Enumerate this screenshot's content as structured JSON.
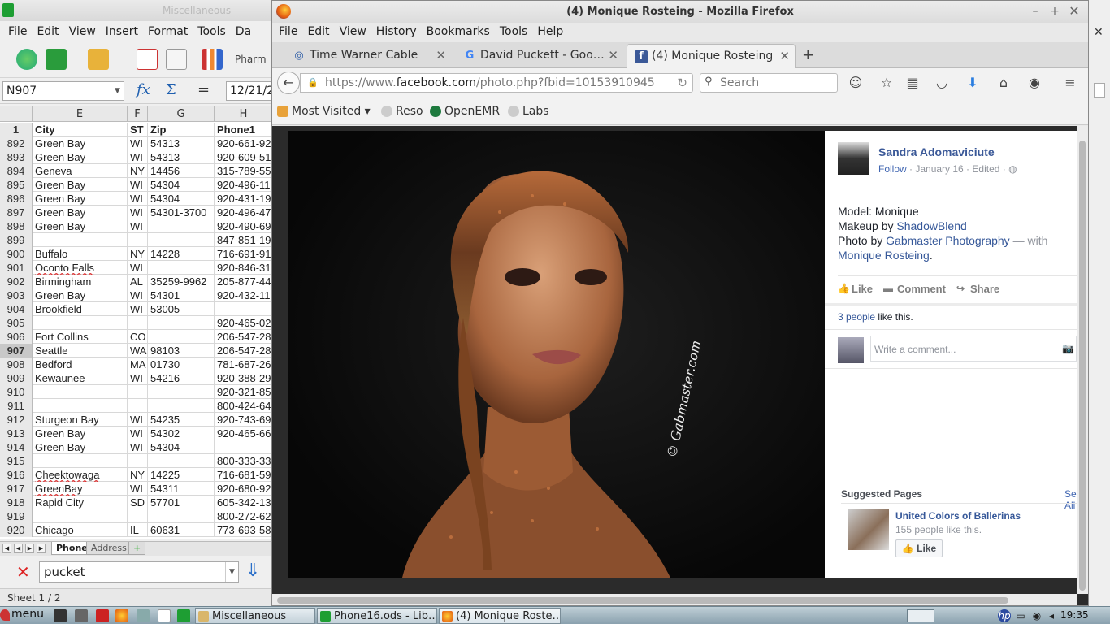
{
  "calc": {
    "title": "Miscellaneous",
    "menu": [
      "File",
      "Edit",
      "View",
      "Insert",
      "Format",
      "Tools",
      "Da"
    ],
    "toolbar_text": "Pharm",
    "name_box": "N907",
    "formula_value": "12/21/2",
    "columns": [
      "E",
      "F",
      "G",
      "H"
    ],
    "rows": [
      {
        "n": "1",
        "city": "City",
        "st": "ST",
        "zip": "Zip",
        "phone": "Phone1",
        "head": true
      },
      {
        "n": "892",
        "city": "Green Bay",
        "st": "WI",
        "zip": "54313",
        "phone": "920-661-92"
      },
      {
        "n": "893",
        "city": "Green Bay",
        "st": "WI",
        "zip": "54313",
        "phone": "920-609-51"
      },
      {
        "n": "894",
        "city": "Geneva",
        "st": "NY",
        "zip": "14456",
        "phone": "315-789-55"
      },
      {
        "n": "895",
        "city": "Green Bay",
        "st": "WI",
        "zip": "54304",
        "phone": "920-496-11"
      },
      {
        "n": "896",
        "city": "Green Bay",
        "st": "WI",
        "zip": "54304",
        "phone": "920-431-19"
      },
      {
        "n": "897",
        "city": "Green Bay",
        "st": "WI",
        "zip": "54301-3700",
        "phone": "920-496-47"
      },
      {
        "n": "898",
        "city": "Green Bay",
        "st": "WI",
        "zip": "",
        "phone": "920-490-69"
      },
      {
        "n": "899",
        "city": "",
        "st": "",
        "zip": "",
        "phone": "847-851-19"
      },
      {
        "n": "900",
        "city": "Buffalo",
        "st": "NY",
        "zip": "14228",
        "phone": "716-691-91"
      },
      {
        "n": "901",
        "city": "Oconto Falls",
        "st": "WI",
        "zip": "",
        "phone": "920-846-31",
        "sq": true
      },
      {
        "n": "902",
        "city": "Birmingham",
        "st": "AL",
        "zip": "35259-9962",
        "phone": "205-877-44"
      },
      {
        "n": "903",
        "city": "Green Bay",
        "st": "WI",
        "zip": "54301",
        "phone": "920-432-11"
      },
      {
        "n": "904",
        "city": "Brookfield",
        "st": "WI",
        "zip": "53005",
        "phone": ""
      },
      {
        "n": "905",
        "city": "",
        "st": "",
        "zip": "",
        "phone": "920-465-02"
      },
      {
        "n": "906",
        "city": "Fort Collins",
        "st": "CO",
        "zip": "",
        "phone": "206-547-28"
      },
      {
        "n": "907",
        "city": "Seattle",
        "st": "WA",
        "zip": "98103",
        "phone": "206-547-28",
        "sel": true
      },
      {
        "n": "908",
        "city": "Bedford",
        "st": "MA",
        "zip": "01730",
        "phone": "781-687-26"
      },
      {
        "n": "909",
        "city": "Kewaunee",
        "st": "WI",
        "zip": "54216",
        "phone": "920-388-29"
      },
      {
        "n": "910",
        "city": "",
        "st": "",
        "zip": "",
        "phone": "920-321-85"
      },
      {
        "n": "911",
        "city": "",
        "st": "",
        "zip": "",
        "phone": "800-424-64"
      },
      {
        "n": "912",
        "city": "Sturgeon Bay",
        "st": "WI",
        "zip": "54235",
        "phone": "920-743-69"
      },
      {
        "n": "913",
        "city": "Green Bay",
        "st": "WI",
        "zip": "54302",
        "phone": "920-465-66"
      },
      {
        "n": "914",
        "city": "Green Bay",
        "st": "WI",
        "zip": "54304",
        "phone": ""
      },
      {
        "n": "915",
        "city": "",
        "st": "",
        "zip": "",
        "phone": "800-333-33"
      },
      {
        "n": "916",
        "city": "Cheektowaga",
        "st": "NY",
        "zip": "14225",
        "phone": "716-681-59",
        "sq": true
      },
      {
        "n": "917",
        "city": "GreenBay",
        "st": "WI",
        "zip": "54311",
        "phone": "920-680-92",
        "sq": true
      },
      {
        "n": "918",
        "city": "Rapid City",
        "st": "SD",
        "zip": "57701",
        "phone": "605-342-13"
      },
      {
        "n": "919",
        "city": "",
        "st": "",
        "zip": "",
        "phone": "800-272-62"
      },
      {
        "n": "920",
        "city": "Chicago",
        "st": "IL",
        "zip": "60631",
        "phone": "773-693-58"
      }
    ],
    "sheet_tabs": [
      "Phone",
      "Address"
    ],
    "find_text": "pucket",
    "status": "Sheet 1 / 2"
  },
  "firefox": {
    "title": "(4) Monique Rosteing - Mozilla Firefox",
    "menu": [
      "File",
      "Edit",
      "View",
      "History",
      "Bookmarks",
      "Tools",
      "Help"
    ],
    "tabs": [
      {
        "label": "Time Warner Cable",
        "icon": "twc-icon"
      },
      {
        "label": "David Puckett - Goo…",
        "icon": "google-icon"
      },
      {
        "label": "(4) Monique Rosteing",
        "icon": "facebook-icon"
      }
    ],
    "url_prefix": "https://www.",
    "url_domain": "facebook.com",
    "url_rest": "/photo.php?fbid=10153910945",
    "search_placeholder": "Search",
    "bookmarks": [
      "Most Visited",
      "Reso",
      "OpenEMR",
      "Labs"
    ]
  },
  "facebook": {
    "author": "Sandra Adomaviciute",
    "follow": "Follow",
    "meta": " · January 16 · Edited · ",
    "caption": {
      "line1": "Model: Monique",
      "makeup_prefix": "Makeup by ",
      "makeup_link": "ShadowBlend",
      "photo_prefix": "Photo by ",
      "photo_link": "Gabmaster Photography",
      "with": " — with ",
      "tagged": "Monique Rosteing",
      "end": "."
    },
    "actions": [
      "Like",
      "Comment",
      "Share"
    ],
    "likes_link": "3 people",
    "likes_text": " like this.",
    "comment_placeholder": "Write a comment...",
    "suggested_header": "Suggested Pages",
    "see_all": "See All",
    "suggested_name": "United Colors of Ballerinas",
    "suggested_count": "155 people like this.",
    "like_button": "Like",
    "watermark": "© Gabmaster.com"
  },
  "taskbar": {
    "menu": "menu",
    "tasks": [
      "Miscellaneous",
      "Phone16.ods - Lib…",
      "(4) Monique Roste…"
    ],
    "clock": "19:35"
  }
}
